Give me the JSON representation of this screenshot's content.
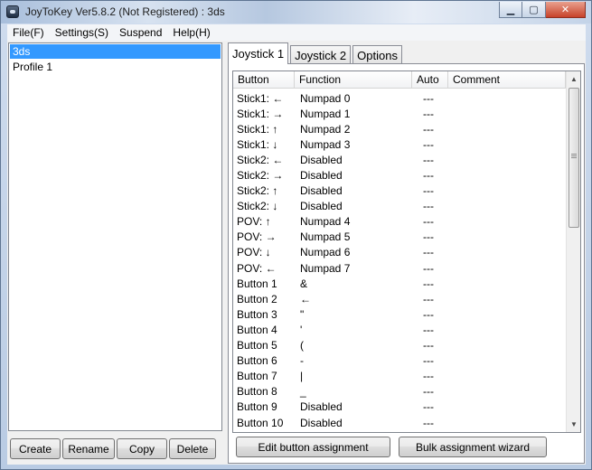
{
  "window": {
    "title": "JoyToKey Ver5.8.2 (Not Registered) : 3ds",
    "minimize_label": "▁",
    "maximize_label": "▢",
    "close_label": "✕"
  },
  "menu": {
    "items": [
      "File(F)",
      "Settings(S)",
      "Suspend",
      "Help(H)"
    ]
  },
  "profiles": {
    "items": [
      "3ds",
      "Profile 1"
    ],
    "selected": "3ds",
    "buttons": [
      "Create",
      "Rename",
      "Copy",
      "Delete"
    ]
  },
  "tabs": {
    "items": [
      "Joystick 1",
      "Joystick 2",
      "Options"
    ],
    "active": "Joystick 1"
  },
  "table": {
    "columns": [
      "Button",
      "Function",
      "Auto",
      "Comment"
    ],
    "rows": [
      {
        "button": "Stick1: ←",
        "function": "Numpad 0",
        "auto": "---",
        "comment": ""
      },
      {
        "button": "Stick1: →",
        "function": "Numpad 1",
        "auto": "---",
        "comment": ""
      },
      {
        "button": "Stick1: ↑",
        "function": "Numpad 2",
        "auto": "---",
        "comment": ""
      },
      {
        "button": "Stick1: ↓",
        "function": "Numpad 3",
        "auto": "---",
        "comment": ""
      },
      {
        "button": "Stick2: ←",
        "function": "Disabled",
        "auto": "---",
        "comment": ""
      },
      {
        "button": "Stick2: →",
        "function": "Disabled",
        "auto": "---",
        "comment": ""
      },
      {
        "button": "Stick2: ↑",
        "function": "Disabled",
        "auto": "---",
        "comment": ""
      },
      {
        "button": "Stick2: ↓",
        "function": "Disabled",
        "auto": "---",
        "comment": ""
      },
      {
        "button": "POV: ↑",
        "function": "Numpad 4",
        "auto": "---",
        "comment": ""
      },
      {
        "button": "POV: →",
        "function": "Numpad 5",
        "auto": "---",
        "comment": ""
      },
      {
        "button": "POV: ↓",
        "function": "Numpad 6",
        "auto": "---",
        "comment": ""
      },
      {
        "button": "POV: ←",
        "function": "Numpad 7",
        "auto": "---",
        "comment": ""
      },
      {
        "button": "Button 1",
        "function": "&",
        "auto": "---",
        "comment": ""
      },
      {
        "button": "Button 2",
        "function": "←",
        "auto": "---",
        "comment": ""
      },
      {
        "button": "Button 3",
        "function": "\"",
        "auto": "---",
        "comment": ""
      },
      {
        "button": "Button 4",
        "function": "'",
        "auto": "---",
        "comment": ""
      },
      {
        "button": "Button 5",
        "function": "(",
        "auto": "---",
        "comment": ""
      },
      {
        "button": "Button 6",
        "function": "-",
        "auto": "---",
        "comment": ""
      },
      {
        "button": "Button 7",
        "function": "|",
        "auto": "---",
        "comment": ""
      },
      {
        "button": "Button 8",
        "function": "_",
        "auto": "---",
        "comment": ""
      },
      {
        "button": "Button 9",
        "function": "Disabled",
        "auto": "---",
        "comment": ""
      },
      {
        "button": "Button 10",
        "function": "Disabled",
        "auto": "---",
        "comment": ""
      }
    ]
  },
  "scrollbar": {
    "up_arrow": "▲",
    "down_arrow": "▼"
  },
  "actions": {
    "edit_label": "Edit button assignment",
    "bulk_label": "Bulk assignment wizard"
  },
  "colors": {
    "selection": "#3399ff",
    "window_frame": "#b9cbe3",
    "close_button": "#c7422a"
  }
}
